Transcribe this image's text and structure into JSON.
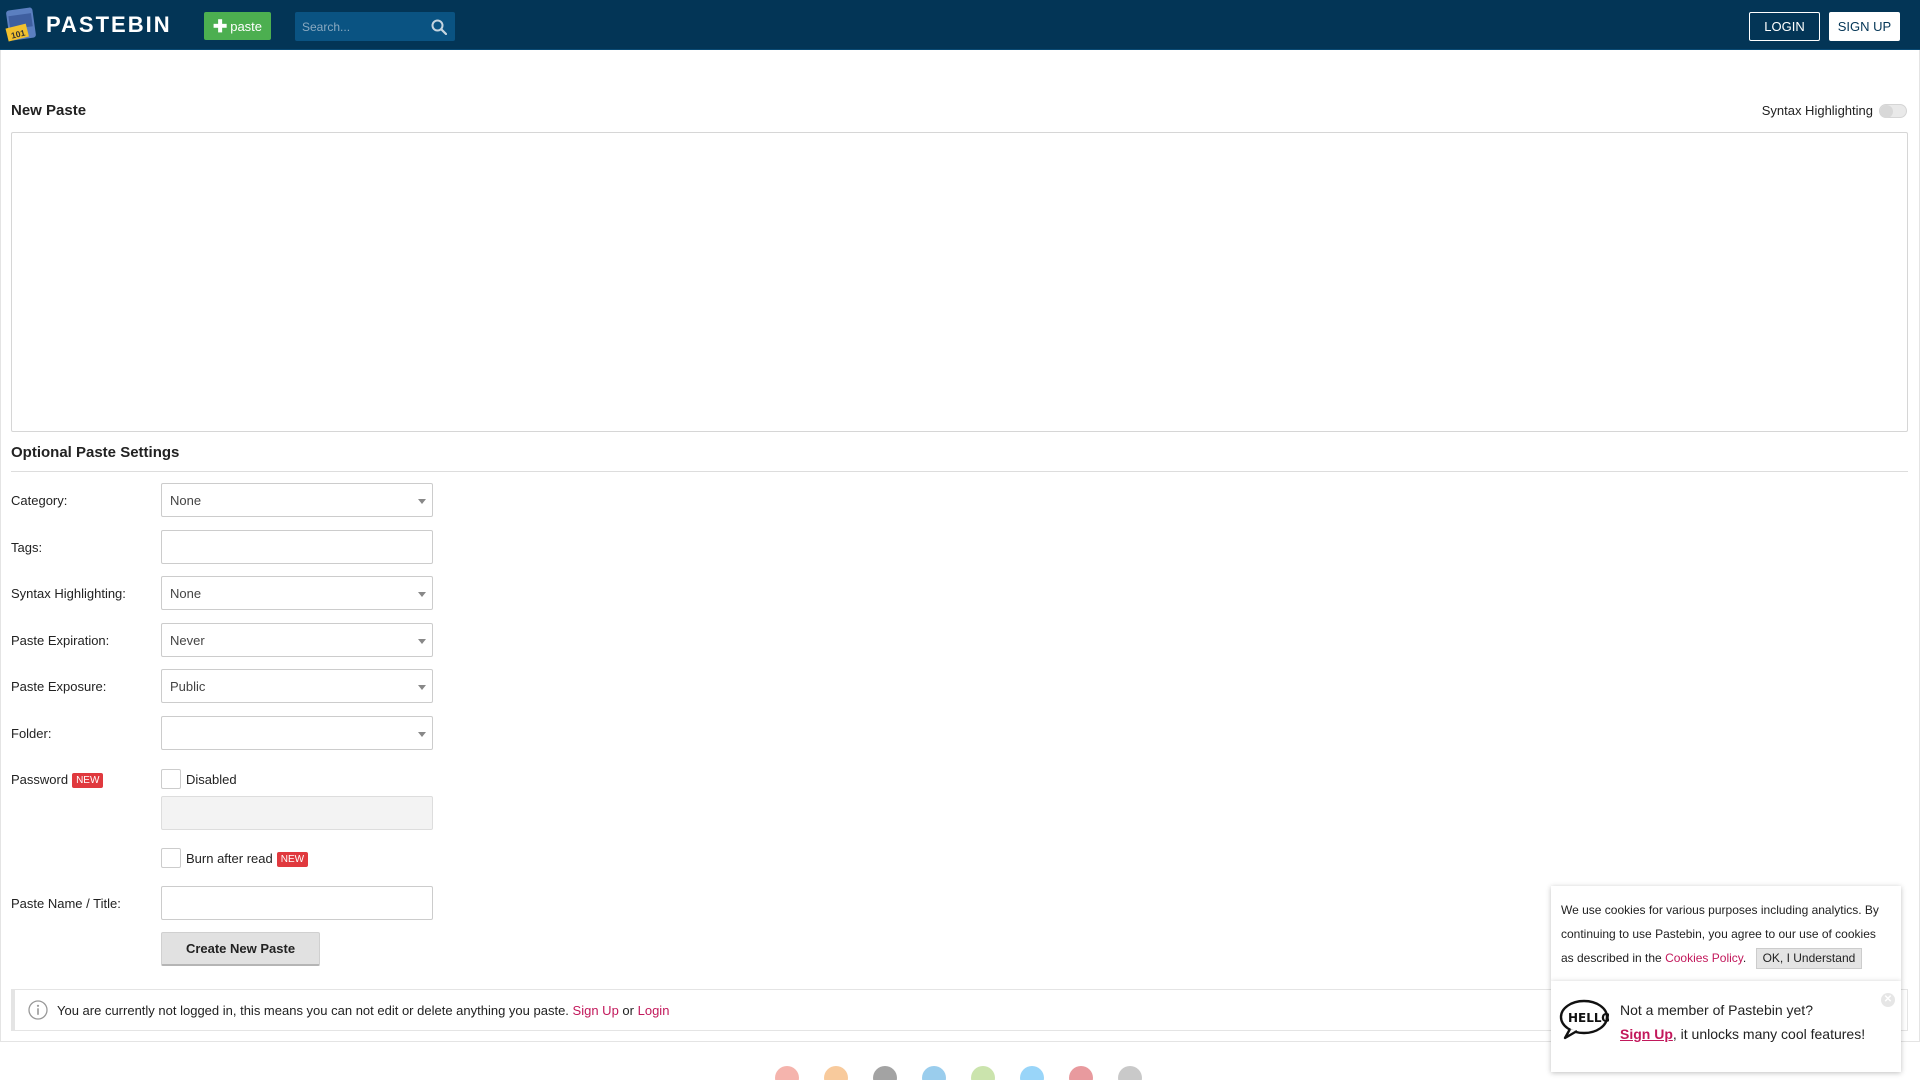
{
  "header": {
    "brand": "PASTEBIN",
    "paste_button_label": "paste",
    "search_placeholder": "Search...",
    "login_label": "LOGIN",
    "signup_label": "SIGN UP"
  },
  "editor": {
    "title": "New Paste",
    "syntax_toggle_label": "Syntax Highlighting",
    "syntax_toggle_on": false
  },
  "settings": {
    "title": "Optional Paste Settings",
    "category": {
      "label": "Category:",
      "value": "None"
    },
    "tags": {
      "label": "Tags:",
      "value": ""
    },
    "syntax": {
      "label": "Syntax Highlighting:",
      "value": "None"
    },
    "expiration": {
      "label": "Paste Expiration:",
      "value": "Never"
    },
    "exposure": {
      "label": "Paste Exposure:",
      "value": "Public"
    },
    "folder": {
      "label": "Folder:",
      "value": ""
    },
    "password": {
      "label": "Password",
      "badge": "NEW",
      "checkbox_label": "Disabled",
      "checked": false
    },
    "burn": {
      "label": "Burn after read",
      "badge": "NEW",
      "checked": false
    },
    "name": {
      "label": "Paste Name / Title:",
      "value": ""
    },
    "create_button": "Create New Paste"
  },
  "notice": {
    "text": "You are currently not logged in, this means you can not edit or delete anything you paste.",
    "signup_link": "Sign Up",
    "or": "or",
    "login_link": "Login"
  },
  "cookie": {
    "text": "We use cookies for various purposes including analytics. By continuing to use Pastebin, you agree to our use of cookies as described in the",
    "policy_link": "Cookies Policy",
    "period": ".",
    "ok_button": "OK, I Understand"
  },
  "promo": {
    "line1": "Not a member of Pastebin yet?",
    "signup_link": "Sign Up",
    "line2_rest": ", it unlocks many cool features!"
  },
  "footer": {
    "icons": [
      "chrome-icon",
      "firefox-icon",
      "creative-commons-icon",
      "windows-icon",
      "android-icon",
      "twitter-icon",
      "pinterest-icon",
      "info-icon"
    ]
  },
  "colors": {
    "header_bg": "#033556",
    "paste_green": "#4caf50",
    "link": "#c2185b",
    "new_badge": "#e0393e"
  }
}
